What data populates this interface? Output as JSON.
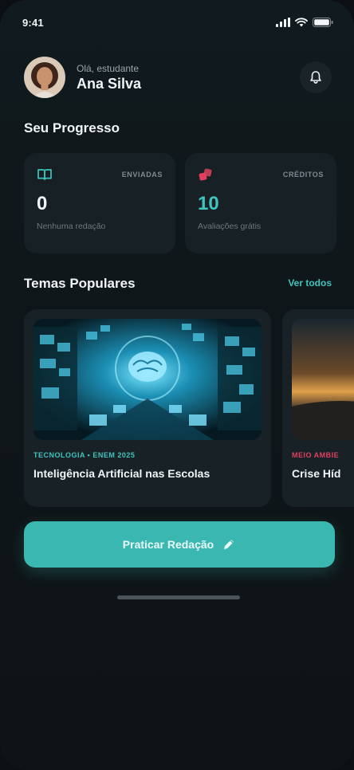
{
  "status_bar": {
    "time": "9:41"
  },
  "header": {
    "greeting": "Olá, estudante",
    "name": "Ana Silva"
  },
  "progress": {
    "title": "Seu Progresso",
    "cards": [
      {
        "label": "ENVIADAS",
        "value": "0",
        "subtitle": "Nenhuma redação",
        "icon": "book-icon",
        "accent": "#3fc4be"
      },
      {
        "label": "CRÉDITOS",
        "value": "10",
        "subtitle": "Avaliações grátis",
        "icon": "credits-icon",
        "accent": "#e0405e"
      }
    ]
  },
  "topics": {
    "title": "Temas Populares",
    "see_all": "Ver todos",
    "items": [
      {
        "tag": "TECNOLOGIA • ENEM 2025",
        "title": "Inteligência Artificial nas Escolas",
        "tag_color": "#3fc4be",
        "image": "ai-brain-image"
      },
      {
        "tag": "MEIO AMBIE",
        "title": "Crise Híd",
        "tag_color": "#e0405e",
        "image": "sunset-image"
      }
    ]
  },
  "cta": {
    "label": "Praticar Redação",
    "icon": "pencil-icon"
  },
  "colors": {
    "accent": "#3bb7b1",
    "background": "#0f1619",
    "card": "#172125",
    "pink": "#e0405e"
  }
}
